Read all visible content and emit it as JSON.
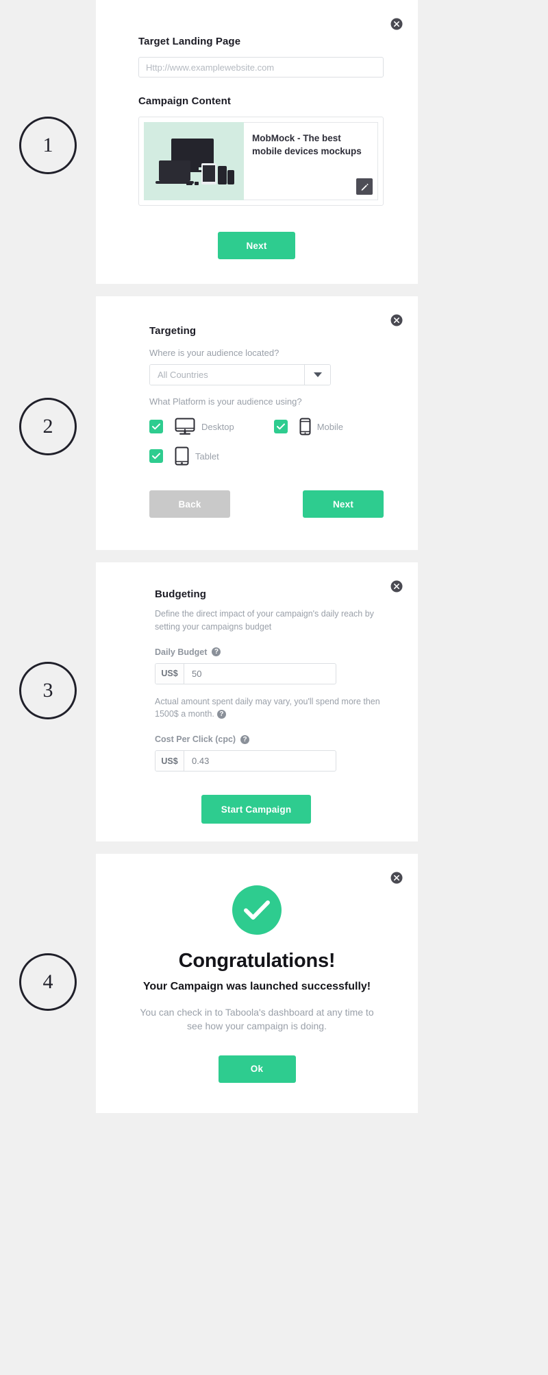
{
  "theme": {
    "accent_green": "#2ecc8f",
    "page_bg": "#f0f0f0",
    "panel_bg": "#ffffff",
    "muted_text": "#9aa0a9",
    "grey_button": "#c9c9c9",
    "thumb_bg": "#d3ece1"
  },
  "steps": [
    {
      "number": "1"
    },
    {
      "number": "2"
    },
    {
      "number": "3"
    },
    {
      "number": "4"
    }
  ],
  "step1": {
    "close_icon": "close-circle-icon",
    "landing_page_label": "Target Landing Page",
    "url_placeholder": "Http://www.examplewebsite.com",
    "url_value": "",
    "campaign_content_label": "Campaign Content",
    "content_card": {
      "thumbnail_icon": "devices-mockup-image",
      "title": "MobMock - The best mobile devices mockups",
      "edit_icon": "pencil-edit-icon"
    },
    "next_label": "Next"
  },
  "step2": {
    "close_icon": "close-circle-icon",
    "title": "Targeting",
    "location_question": "Where is your audience located?",
    "location_value": "All Countries",
    "location_options": [
      "All Countries"
    ],
    "dropdown_icon": "chevron-down-icon",
    "platform_question": "What Platform is your audience using?",
    "platforms": [
      {
        "label": "Desktop",
        "checked": true,
        "icon": "desktop-monitor-icon"
      },
      {
        "label": "Mobile",
        "checked": true,
        "icon": "mobile-phone-icon"
      },
      {
        "label": "Tablet",
        "checked": true,
        "icon": "tablet-icon"
      }
    ],
    "back_label": "Back",
    "next_label": "Next"
  },
  "step3": {
    "close_icon": "close-circle-icon",
    "title": "Budgeting",
    "description": "Define the direct impact of your campaign's daily reach by setting your campaigns budget",
    "daily_budget_label": "Daily Budget",
    "daily_budget_help_icon": "question-mark-icon",
    "daily_budget_currency": "US$",
    "daily_budget_value": "50",
    "spend_note": "Actual amount spent daily may vary, you'll spend more then 1500$ a month.",
    "spend_note_help_icon": "question-mark-icon",
    "cpc_label": "Cost Per Click (cpc)",
    "cpc_help_icon": "question-mark-icon",
    "cpc_currency": "US$",
    "cpc_value": "0.43",
    "start_label": "Start Campaign"
  },
  "step4": {
    "close_icon": "close-circle-icon",
    "success_icon": "check-circle-icon",
    "title": "Congratulations!",
    "subtitle": "Your Campaign was launched successfully!",
    "body": "You can check in to Taboola's dashboard at any time to see how your campaign is doing.",
    "ok_label": "Ok"
  }
}
